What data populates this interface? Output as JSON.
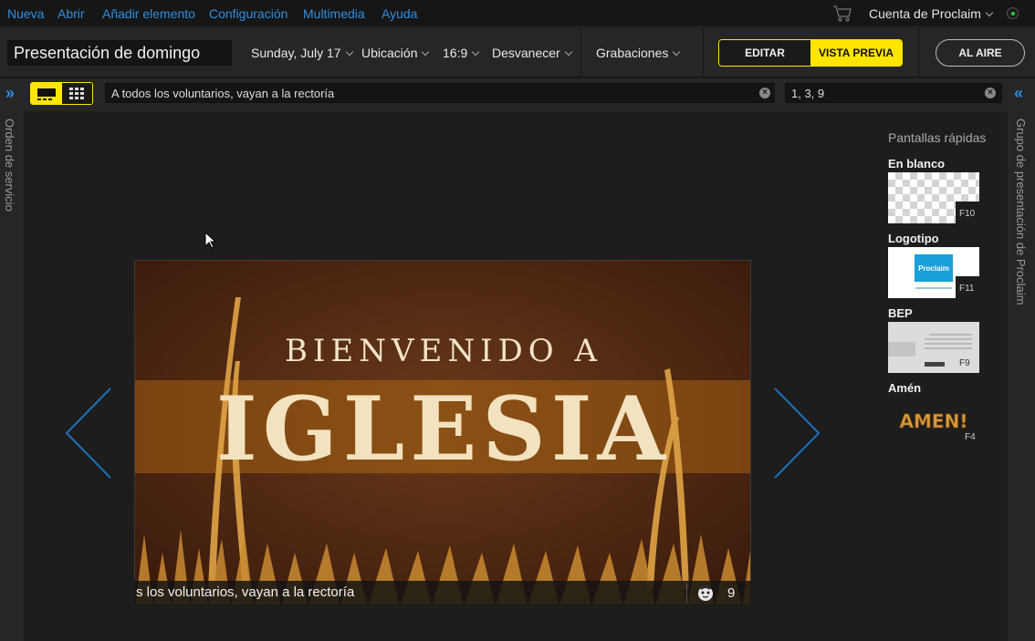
{
  "menu": {
    "items": [
      "Nueva",
      "Abrir",
      "Añadir elemento",
      "Configuración",
      "Multimedia",
      "Ayuda"
    ],
    "account_label": "Cuenta de Proclaim"
  },
  "toolbar": {
    "presentation_title": "Presentación de domingo",
    "date": "Sunday, July 17",
    "location": "Ubicación",
    "aspect": "16:9",
    "transition": "Desvanecer",
    "recordings": "Grabaciones",
    "edit_label": "EDITAR",
    "preview_label": "VISTA PREVIA",
    "onair_label": "AL AIRE"
  },
  "subbar": {
    "announcement_text": "A todos los voluntarios, vayan a la rectoría",
    "slides_filter": "1, 3, 9"
  },
  "panels": {
    "left_label": "Orden de servicio",
    "right_label": "Grupo de presentación de Proclaim"
  },
  "slide": {
    "line1": "BIENVENIDO A",
    "line2": "IGLESIA",
    "caption": "s los voluntarios, vayan a la rectoría",
    "count": "9"
  },
  "quick_screens": {
    "title": "Pantallas rápidas",
    "items": [
      {
        "label": "En blanco",
        "key": "F10"
      },
      {
        "label": "Logotipo",
        "key": "F11",
        "logo_text": "Proclaim"
      },
      {
        "label": "BEP",
        "key": "F9"
      },
      {
        "label": "Amén",
        "key": "F4",
        "image_text": "AMEN!"
      }
    ]
  },
  "colors": {
    "accent_blue": "#2f8fe0",
    "accent_yellow": "#ffe600",
    "background": "#1d1d1d"
  },
  "icons": [
    "cart-icon",
    "chevron-down-icon",
    "expand-icon",
    "single-view-icon",
    "grid-view-icon",
    "clear-icon",
    "prev-arrow-icon",
    "next-arrow-icon",
    "face-icon",
    "status-icon"
  ]
}
